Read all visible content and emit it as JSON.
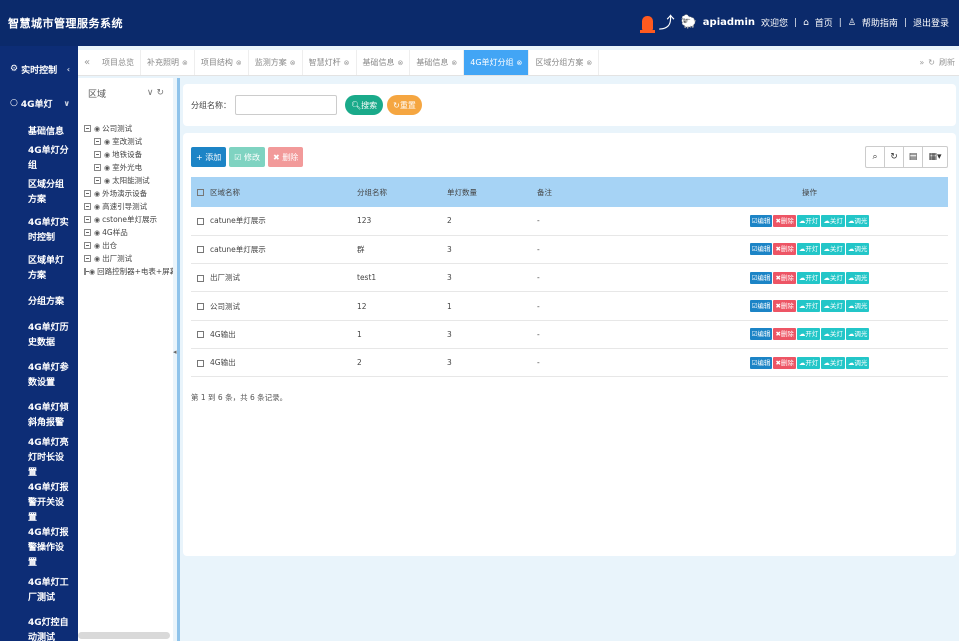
{
  "header": {
    "title": "智慧城市管理服务系统",
    "username": "apiadmin",
    "welcome": "欢迎您",
    "home": "首页",
    "help": "帮助指南",
    "logout": "退出登录"
  },
  "sidebar": {
    "items": [
      {
        "label": "实时控制",
        "chev": "‹"
      },
      {
        "label": "4G单灯",
        "chev": "∨"
      }
    ],
    "subitems": [
      "基础信息",
      "4G单灯分组",
      "区域分组方案",
      "4G单灯实时控制",
      "区域单灯方案",
      "分组方案",
      "4G单灯历史数据",
      "4G单灯参数设置",
      "4G单灯倾斜角报警",
      "4G单灯亮灯时长设置",
      "4G单灯报警开关设置",
      "4G单灯报警操作设置",
      "4G单灯工厂测试",
      "4G灯控自动测试"
    ]
  },
  "tabs": {
    "items": [
      {
        "label": "项目总览",
        "closable": false
      },
      {
        "label": "补充照明",
        "closable": true
      },
      {
        "label": "项目结构",
        "closable": true
      },
      {
        "label": "监测方案",
        "closable": true
      },
      {
        "label": "智慧灯杆",
        "closable": true
      },
      {
        "label": "基础信息",
        "closable": true
      },
      {
        "label": "基础信息",
        "closable": true
      },
      {
        "label": "4G单灯分组",
        "closable": true,
        "active": true
      },
      {
        "label": "区域分组方案",
        "closable": true
      }
    ],
    "refresh": "刷新"
  },
  "tree": {
    "title": "区域",
    "nodes": [
      {
        "label": "公司测试",
        "level": 0
      },
      {
        "label": "室改测试",
        "level": 1
      },
      {
        "label": "地铁设备",
        "level": 1
      },
      {
        "label": "室外光电",
        "level": 1
      },
      {
        "label": "太阳能测试",
        "level": 1
      },
      {
        "label": "外场演示设备",
        "level": 0
      },
      {
        "label": "高速引导测试",
        "level": 0
      },
      {
        "label": "cstone单灯展示",
        "level": 0
      },
      {
        "label": "4G样品",
        "level": 0
      },
      {
        "label": "出仓",
        "level": 0
      },
      {
        "label": "出厂测试",
        "level": 0
      },
      {
        "label": "回路控制器+电表+屏幕",
        "level": 0
      }
    ]
  },
  "search": {
    "label": "分组名称：",
    "value": "",
    "search_btn": "搜索",
    "reset_btn": "重置"
  },
  "toolbar": {
    "add": "+ 添加",
    "edit": "☑ 修改",
    "delete": "✖ 删除"
  },
  "table": {
    "headers": [
      "区域名称",
      "分组名称",
      "单灯数量",
      "备注",
      "操作"
    ],
    "rows": [
      {
        "area": "catune单灯展示",
        "group": "123",
        "count": "2",
        "note": "-"
      },
      {
        "area": "catune单灯展示",
        "group": "群",
        "count": "3",
        "note": "-"
      },
      {
        "area": "出厂测试",
        "group": "test1",
        "count": "3",
        "note": "-"
      },
      {
        "area": "公司测试",
        "group": "12",
        "count": "1",
        "note": "-"
      },
      {
        "area": "4G输出",
        "group": "1",
        "count": "3",
        "note": "-"
      },
      {
        "area": "4G输出",
        "group": "2",
        "count": "3",
        "note": "-"
      }
    ],
    "ops": {
      "edit": "☑编辑",
      "delete": "✖删除",
      "on": "☁开灯",
      "off": "☁关灯",
      "dim": "☁调光"
    }
  },
  "pagination": {
    "info": "第 1 到 6 条，共 6 条记录。"
  },
  "colors": {
    "header_bg": "#0b2a6b",
    "sidebar_bg": "#0d2d76",
    "active_tab": "#42a5f5",
    "table_header": "#a6d3f5"
  }
}
